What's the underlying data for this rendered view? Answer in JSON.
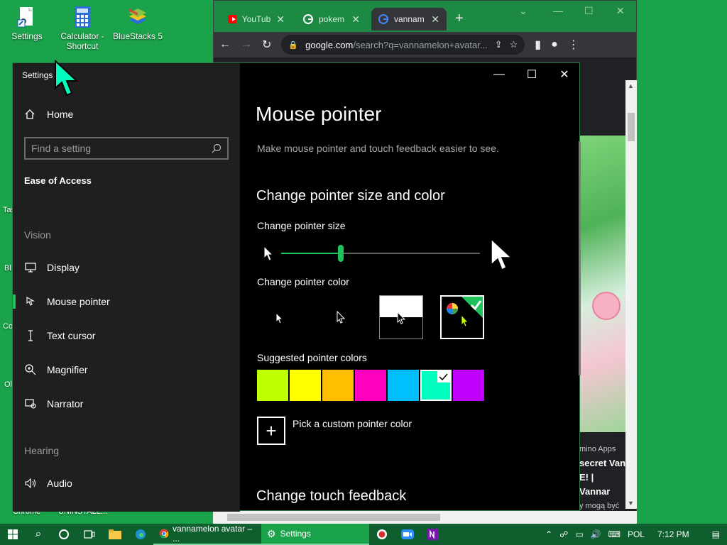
{
  "desktop": {
    "icons": [
      {
        "label": "Settings"
      },
      {
        "label": "Calculator - Shortcut"
      },
      {
        "label": "BlueStacks 5"
      }
    ],
    "edge_labels": [
      "Tas",
      "Bl",
      "Co",
      "Ol"
    ],
    "bottom_labels": [
      "Chrome",
      "UNINSTALL..."
    ]
  },
  "chrome": {
    "tabs": [
      {
        "label": "YouTub"
      },
      {
        "label": "pokem"
      },
      {
        "label": "vannam"
      }
    ],
    "url_host": "google.com",
    "url_path": "/search?q=vannamelon+avatar...",
    "caption_source": "mino Apps",
    "caption_line1": "secret Van",
    "caption_line2": "E! | Vannar",
    "caption_line3": "y mogą być"
  },
  "settings": {
    "window_title": "Settings",
    "home_label": "Home",
    "search_placeholder": "Find a setting",
    "category": "Ease of Access",
    "group_vision": "Vision",
    "group_hearing": "Hearing",
    "nav": [
      {
        "label": "Display",
        "icon": "monitor-icon"
      },
      {
        "label": "Mouse pointer",
        "icon": "pointer-hand-icon"
      },
      {
        "label": "Text cursor",
        "icon": "text-cursor-icon"
      },
      {
        "label": "Magnifier",
        "icon": "magnifier-icon"
      },
      {
        "label": "Narrator",
        "icon": "narrator-icon"
      },
      {
        "label": "Audio",
        "icon": "speaker-icon"
      }
    ],
    "page_title": "Mouse pointer",
    "page_subtitle": "Make mouse pointer and touch feedback easier to see.",
    "section1": "Change pointer size and color",
    "size_label": "Change pointer size",
    "size_level": 0.3,
    "color_label": "Change pointer color",
    "suggested_label": "Suggested pointer colors",
    "swatches": [
      "#bfff00",
      "#ffff00",
      "#ffbf00",
      "#ff00bf",
      "#00bfff",
      "#00ffbf",
      "#bf00ff"
    ],
    "selected_swatch": 5,
    "custom_label": "Pick a custom pointer color",
    "section2": "Change touch feedback"
  },
  "taskbar": {
    "chrome_label": "vannamelon avatar – ...",
    "settings_label": "Settings",
    "lang": "POL",
    "time": "7:12 PM"
  },
  "colors": {
    "accent": "#1ec25a",
    "desktop": "#1aa34a",
    "taskbar": "#0f5e2e"
  }
}
